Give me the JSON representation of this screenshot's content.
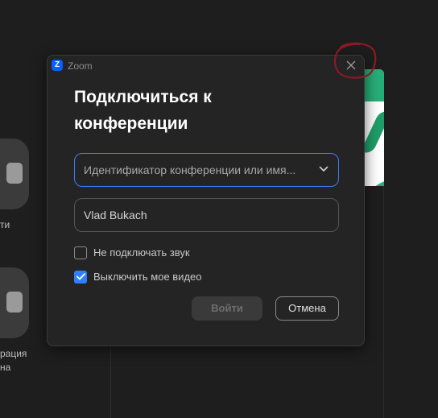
{
  "window": {
    "app_title": "Zoom",
    "logo_letter": "Z"
  },
  "background": {
    "label_1": "ти",
    "label_2_line1": "рация",
    "label_2_line2": "на"
  },
  "dialog": {
    "title_line1": "Подключиться к",
    "title_line2": "конференции",
    "meeting_id_placeholder": "Идентификатор конференции или имя...",
    "name_value": "Vlad Bukach",
    "options": [
      {
        "label": "Не подключать звук",
        "checked": false
      },
      {
        "label": "Выключить мое видео",
        "checked": true
      }
    ],
    "join_label": "Войти",
    "cancel_label": "Отмена"
  },
  "colors": {
    "accent": "#2f80ff",
    "focus_border": "#3d7ef5",
    "brand": "#0b5cff",
    "annotation": "#8b1a24"
  },
  "icons": [
    "zoom-logo-icon",
    "close-icon",
    "chevron-down-icon",
    "checkmark-icon"
  ]
}
